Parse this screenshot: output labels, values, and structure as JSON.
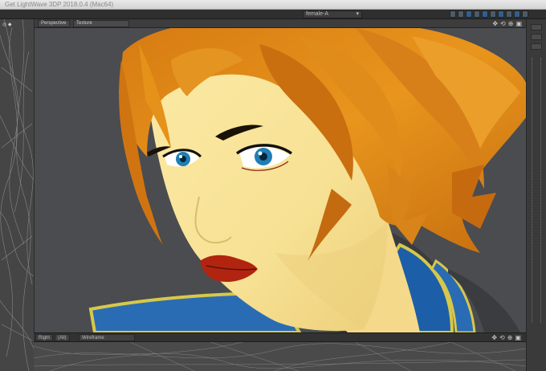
{
  "app": {
    "title": "Get LightWave 3DP 2018.0.4 (Mac64)"
  },
  "topbar": {
    "scene_object": "female-A"
  },
  "viewport": {
    "view_mode": "Perspective",
    "shading": "Texture",
    "header_icons": [
      "move-icon",
      "rotate-icon",
      "zoom-icon",
      "maximize-icon"
    ]
  },
  "bottom_viewport": {
    "view_mode": "Right",
    "view_option": "(All)",
    "shading": "Wireframe"
  },
  "colors": {
    "hair": "#e3901c",
    "skin": "#f7e398",
    "lips": "#b12510",
    "iris": "#1f7fb4",
    "collar_blue": "#2a6cb3",
    "collar_trim": "#d7c84a",
    "viewport_bg": "#4a4c50"
  }
}
